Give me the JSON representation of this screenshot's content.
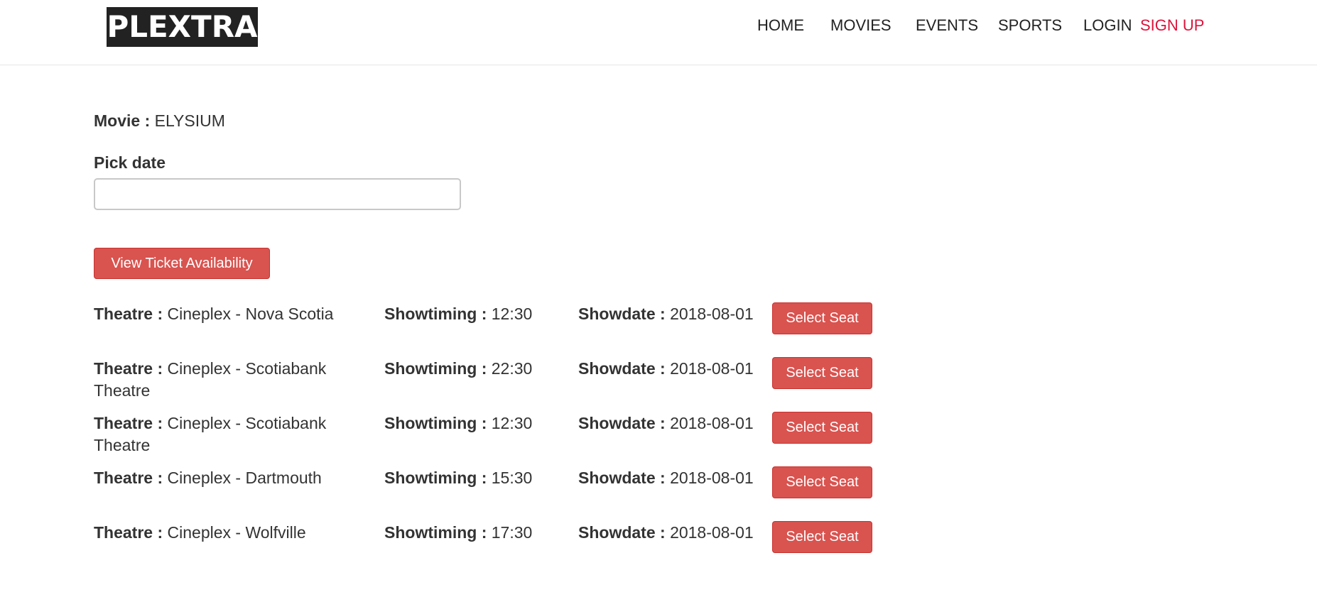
{
  "nav": {
    "logo": "PLEXTRA",
    "items": [
      "HOME",
      "MOVIES",
      "EVENTS",
      "SPORTS",
      "LOGIN"
    ],
    "signup": "SIGN UP",
    "signup_color": "#dc143c"
  },
  "movie": {
    "label": "Movie :",
    "value": "ELYSIUM"
  },
  "pick_date": {
    "label": "Pick date",
    "value": ""
  },
  "view_button": "View Ticket Availability",
  "labels": {
    "theatre": "Theatre :",
    "showtiming": "Showtiming :",
    "showdate": "Showdate :",
    "select_seat": "Select Seat"
  },
  "showtimes": [
    {
      "theatre": "Cineplex - Nova Scotia",
      "showtiming": "12:30",
      "showdate": "2018-08-01"
    },
    {
      "theatre": "Cineplex - Scotiabank Theatre",
      "showtiming": "22:30",
      "showdate": "2018-08-01"
    },
    {
      "theatre": "Cineplex - Scotiabank Theatre",
      "showtiming": "12:30",
      "showdate": "2018-08-01"
    },
    {
      "theatre": "Cineplex - Dartmouth",
      "showtiming": "15:30",
      "showdate": "2018-08-01"
    },
    {
      "theatre": "Cineplex - Wolfville",
      "showtiming": "17:30",
      "showdate": "2018-08-01"
    }
  ],
  "colors": {
    "accent_button": "#d9534f",
    "logo_bg": "#222222"
  }
}
